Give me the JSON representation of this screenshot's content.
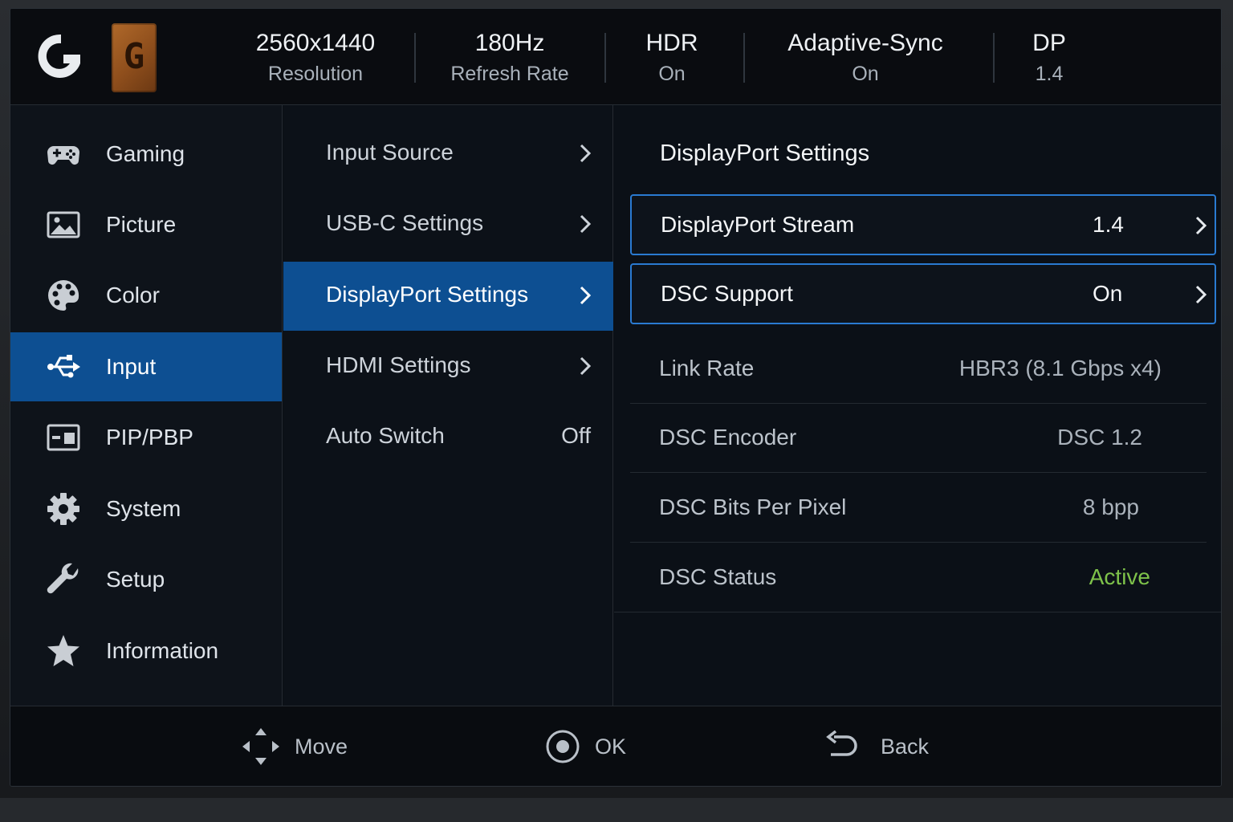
{
  "header": {
    "stats": [
      {
        "value": "2560x1440",
        "label": "Resolution"
      },
      {
        "value": "180Hz",
        "label": "Refresh Rate"
      },
      {
        "value": "HDR",
        "label": "On"
      },
      {
        "value": "Adaptive-Sync",
        "label": "On"
      },
      {
        "value": "DP",
        "label": "1.4"
      }
    ],
    "brand_icon": "logitech-g-logo",
    "avatar_letter": "G"
  },
  "nav": {
    "items": [
      {
        "label": "Gaming",
        "icon": "gamepad-icon"
      },
      {
        "label": "Picture",
        "icon": "picture-icon"
      },
      {
        "label": "Color",
        "icon": "palette-icon"
      },
      {
        "label": "Input",
        "icon": "usb-icon",
        "active": true
      },
      {
        "label": "PIP/PBP",
        "icon": "pip-icon"
      },
      {
        "label": "System",
        "icon": "gear-icon"
      },
      {
        "label": "Setup",
        "icon": "wrench-icon"
      },
      {
        "label": "Information",
        "icon": "star-icon"
      }
    ]
  },
  "submenu": {
    "items": [
      {
        "label": "Input Source"
      },
      {
        "label": "USB-C Settings"
      },
      {
        "label": "DisplayPort Settings",
        "active": true
      },
      {
        "label": "HDMI Settings"
      },
      {
        "label": "Auto Switch",
        "value": "Off"
      }
    ]
  },
  "detail": {
    "title": "DisplayPort Settings",
    "options": [
      {
        "label": "DisplayPort Stream",
        "value": "1.4"
      },
      {
        "label": "DSC Support",
        "value": "On"
      }
    ],
    "info": [
      {
        "label": "Link Rate",
        "value": "HBR3 (8.1 Gbps x4)"
      },
      {
        "label": "DSC Encoder",
        "value": "DSC 1.2"
      },
      {
        "label": "DSC Bits Per Pixel",
        "value": "8 bpp"
      },
      {
        "label": "DSC Status",
        "value": "Active"
      }
    ]
  },
  "footer": {
    "move": "Move",
    "ok": "OK",
    "back": "Back"
  },
  "colors": {
    "accent": "#0d4f92",
    "focus_border": "#2a7ad1",
    "status_active": "#7ec24a",
    "background": "#0b0f15"
  }
}
